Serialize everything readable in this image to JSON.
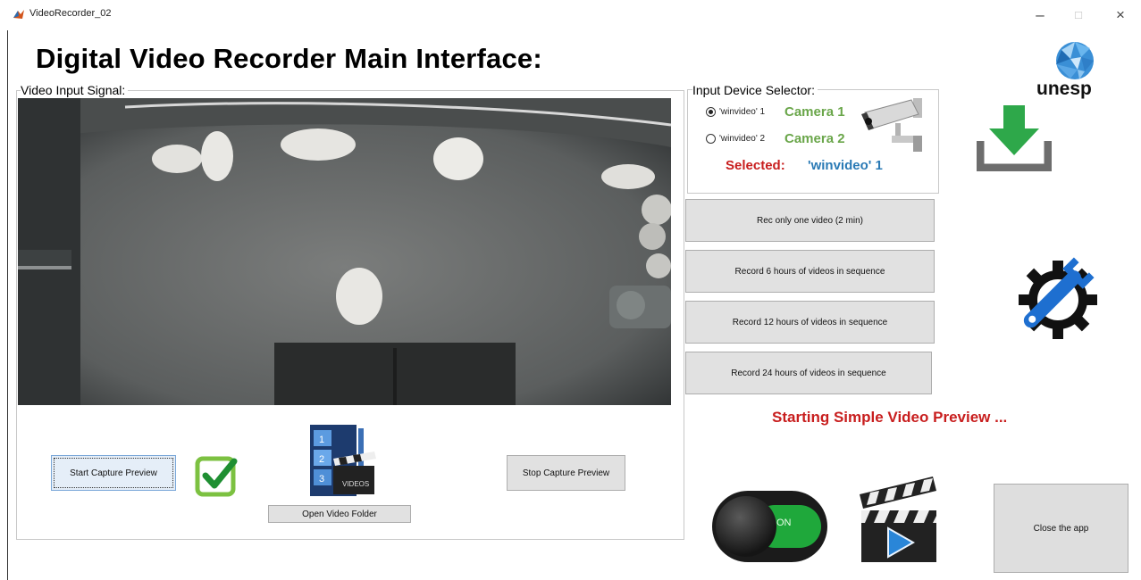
{
  "window": {
    "title": "VideoRecorder_02",
    "minimize_glyph": "–",
    "maximize_glyph": "□",
    "close_glyph": "×"
  },
  "header": {
    "title": "Digital Video Recorder Main Interface:",
    "logo_text": "unesp"
  },
  "video_panel": {
    "label": "Video Input Signal:"
  },
  "preview_controls": {
    "start_label": "Start Capture Preview",
    "stop_label": "Stop Capture Preview",
    "open_folder_label": "Open Video Folder"
  },
  "device_selector": {
    "label": "Input Device Selector:",
    "options": [
      {
        "name": "'winvideo' 1",
        "camera": "Camera 1",
        "checked": true
      },
      {
        "name": "'winvideo' 2",
        "camera": "Camera 2",
        "checked": false
      }
    ],
    "selected_label": "Selected:",
    "selected_value": "'winvideo' 1"
  },
  "record_buttons": [
    {
      "label": "Rec only one video (2 min)"
    },
    {
      "label": "Record 6 hours of videos in sequence"
    },
    {
      "label": "Record 12 hours of videos in sequence"
    },
    {
      "label": "Record 24 hours of videos in sequence"
    }
  ],
  "status": {
    "message": "Starting Simple Video Preview ..."
  },
  "toggle": {
    "state_label": "ON"
  },
  "close_app": {
    "label": "Close the app"
  },
  "icons": {
    "app": "matlab-icon",
    "download": "download-icon",
    "settings": "wrench-gear-icon",
    "checkmark": "checkmark-icon",
    "video_folder": "video-folder-icon",
    "camera": "security-camera-icon",
    "play": "clapperboard-play-icon"
  },
  "colors": {
    "status_red": "#c81e1e",
    "camera_green": "#6aa64a",
    "selected_blue": "#2a7ab5",
    "download_green": "#2ea84a",
    "settings_blue": "#1e6fd0",
    "toggle_green": "#1fa83b"
  }
}
